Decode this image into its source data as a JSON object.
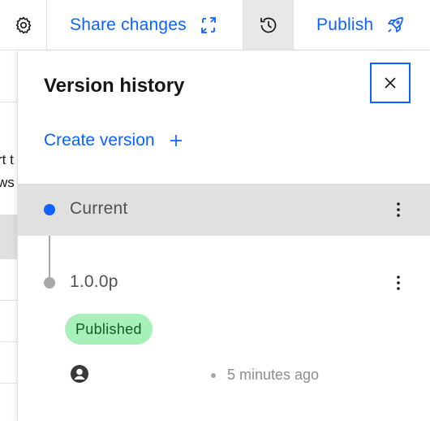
{
  "toolbar": {
    "settings_icon": "gear-icon",
    "share_label": "Share changes",
    "share_icon": "share-arrows-icon",
    "history_icon": "history-clock-icon",
    "publish_label": "Publish",
    "publish_icon": "rocket-icon"
  },
  "background": {
    "text_line_1": "rt t",
    "text_line_2": "ws"
  },
  "panel": {
    "title": "Version history",
    "close_icon": "close-icon",
    "create_version_label": "Create version",
    "create_version_icon": "plus-icon",
    "versions": [
      {
        "label": "Current",
        "selected": true,
        "marker_color": "#0f62fe"
      },
      {
        "label": "1.0.0p",
        "status": "Published",
        "avatar_icon": "user-avatar-icon",
        "timestamp": "5 minutes ago",
        "marker_color": "#a8a8a8"
      }
    ]
  },
  "colors": {
    "accent": "#0f62fe",
    "selected_row": "#e0e0e0",
    "published_bg": "#a7f0ba",
    "published_text": "#0e6027",
    "muted_text": "#8d8d8d"
  }
}
